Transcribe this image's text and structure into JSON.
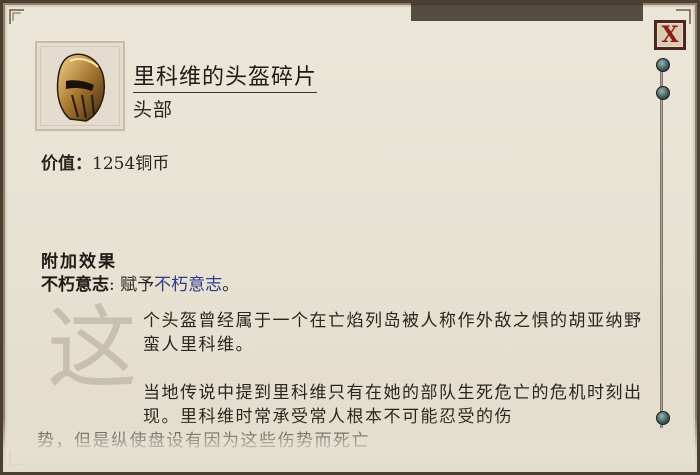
{
  "window": {
    "close_label": "X"
  },
  "item": {
    "name": "里科维的头盔碎片",
    "slot": "头部",
    "price_label": "价值：",
    "price_value": "1254铜币",
    "icon": "helmet-icon"
  },
  "effects": {
    "heading": "附加效果",
    "name": "不朽意志",
    "separator": ": 赋予",
    "link": "不朽意志",
    "end": "。"
  },
  "description": {
    "dropcap": "这",
    "para1": "个头盔曾经属于一个在亡焰列岛被人称作外敌之惧的胡亚纳野蛮人里科维。",
    "para2": "当地传说中提到里科维只有在她的部队生死危亡的危机时刻出现。里科维时常承受常人根本不可能忍受的伤",
    "para3": "势，但是纵使盘设有因为这些伤势而死亡"
  },
  "colors": {
    "parchment": "#e7e1d2",
    "frame": "#4a3f30",
    "link": "#2f3a8a",
    "close": "#8a1c16"
  }
}
